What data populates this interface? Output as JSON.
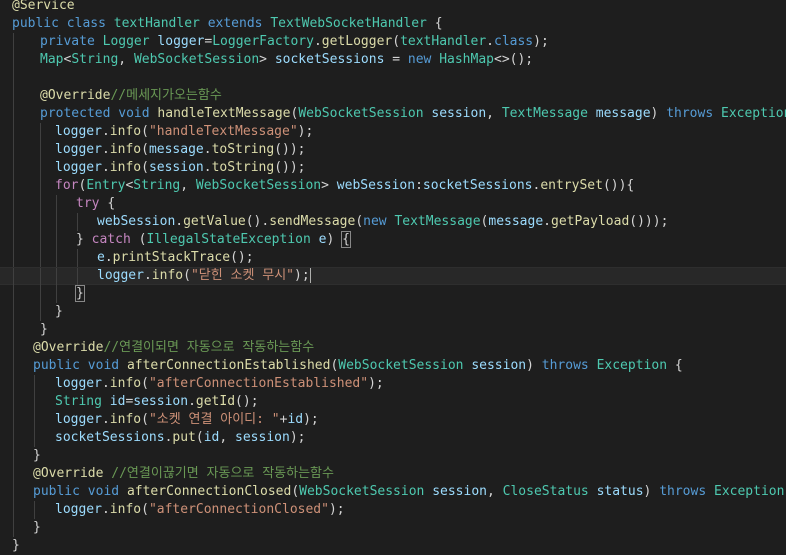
{
  "editor": {
    "language": "java",
    "theme_colors": {
      "background": "#1e1e1e",
      "keyword": "#569cd6",
      "control": "#c586c0",
      "type": "#4ec9b0",
      "variable": "#9cdcfe",
      "function": "#dcdcaa",
      "string": "#ce9178",
      "comment": "#6a9955",
      "text": "#d4d4d4"
    },
    "lines": [
      {
        "tokens": [
          [
            "ann",
            "@"
          ],
          [
            "ann",
            "Service"
          ]
        ]
      },
      {
        "tokens": [
          [
            "kw",
            "public "
          ],
          [
            "kw",
            "class "
          ],
          [
            "type",
            "textHandler "
          ],
          [
            "kw",
            "extends "
          ],
          [
            "type",
            "TextWebSocketHandler "
          ],
          [
            "plain",
            "{"
          ]
        ]
      },
      {
        "tokens": [
          [
            "kw",
            "private "
          ],
          [
            "type",
            "Logger "
          ],
          [
            "var",
            "logger"
          ],
          [
            "plain",
            "="
          ],
          [
            "type",
            "LoggerFactory"
          ],
          [
            "plain",
            "."
          ],
          [
            "fn",
            "getLogger"
          ],
          [
            "plain",
            "("
          ],
          [
            "type",
            "textHandler"
          ],
          [
            "plain",
            "."
          ],
          [
            "kw",
            "class"
          ],
          [
            "plain",
            ");"
          ]
        ]
      },
      {
        "tokens": [
          [
            "type",
            "Map"
          ],
          [
            "plain",
            "<"
          ],
          [
            "type",
            "String"
          ],
          [
            "plain",
            ", "
          ],
          [
            "type",
            "WebSocketSession"
          ],
          [
            "plain",
            "> "
          ],
          [
            "var",
            "socketSessions "
          ],
          [
            "plain",
            "= "
          ],
          [
            "kw",
            "new "
          ],
          [
            "type",
            "HashMap"
          ],
          [
            "plain",
            "<>();"
          ]
        ]
      },
      {
        "tokens": []
      },
      {
        "tokens": [
          [
            "ann",
            "@Override"
          ],
          [
            "cmt",
            "//메세지가오는함수"
          ]
        ]
      },
      {
        "tokens": [
          [
            "kw",
            "protected "
          ],
          [
            "kw",
            "void "
          ],
          [
            "fn",
            "handleTextMessage"
          ],
          [
            "plain",
            "("
          ],
          [
            "type",
            "WebSocketSession "
          ],
          [
            "var",
            "session"
          ],
          [
            "plain",
            ", "
          ],
          [
            "type",
            "TextMessage "
          ],
          [
            "var",
            "message"
          ],
          [
            "plain",
            ") "
          ],
          [
            "kw",
            "throws "
          ],
          [
            "type",
            "Exception "
          ],
          [
            "plain",
            "{"
          ]
        ]
      },
      {
        "tokens": [
          [
            "var",
            "logger"
          ],
          [
            "plain",
            "."
          ],
          [
            "fn",
            "info"
          ],
          [
            "plain",
            "("
          ],
          [
            "str",
            "\"handleTextMessage\""
          ],
          [
            "plain",
            ");"
          ]
        ]
      },
      {
        "tokens": [
          [
            "var",
            "logger"
          ],
          [
            "plain",
            "."
          ],
          [
            "fn",
            "info"
          ],
          [
            "plain",
            "("
          ],
          [
            "var",
            "message"
          ],
          [
            "plain",
            "."
          ],
          [
            "fn",
            "toString"
          ],
          [
            "plain",
            "());"
          ]
        ]
      },
      {
        "tokens": [
          [
            "var",
            "logger"
          ],
          [
            "plain",
            "."
          ],
          [
            "fn",
            "info"
          ],
          [
            "plain",
            "("
          ],
          [
            "var",
            "session"
          ],
          [
            "plain",
            "."
          ],
          [
            "fn",
            "toString"
          ],
          [
            "plain",
            "());"
          ]
        ]
      },
      {
        "tokens": [
          [
            "ctrl",
            "for"
          ],
          [
            "plain",
            "("
          ],
          [
            "type",
            "Entry"
          ],
          [
            "plain",
            "<"
          ],
          [
            "type",
            "String"
          ],
          [
            "plain",
            ", "
          ],
          [
            "type",
            "WebSocketSession"
          ],
          [
            "plain",
            "> "
          ],
          [
            "var",
            "webSession"
          ],
          [
            "plain",
            ":"
          ],
          [
            "var",
            "socketSessions"
          ],
          [
            "plain",
            "."
          ],
          [
            "fn",
            "entrySet"
          ],
          [
            "plain",
            "()){"
          ]
        ]
      },
      {
        "tokens": [
          [
            "ctrl",
            "try "
          ],
          [
            "plain",
            "{"
          ]
        ]
      },
      {
        "tokens": [
          [
            "var",
            "webSession"
          ],
          [
            "plain",
            "."
          ],
          [
            "fn",
            "getValue"
          ],
          [
            "plain",
            "()."
          ],
          [
            "fn",
            "sendMessage"
          ],
          [
            "plain",
            "("
          ],
          [
            "kw",
            "new "
          ],
          [
            "type",
            "TextMessage"
          ],
          [
            "plain",
            "("
          ],
          [
            "var",
            "message"
          ],
          [
            "plain",
            "."
          ],
          [
            "fn",
            "getPayload"
          ],
          [
            "plain",
            "()));"
          ]
        ]
      },
      {
        "tokens": [
          [
            "plain",
            "} "
          ],
          [
            "ctrl",
            "catch "
          ],
          [
            "plain",
            "("
          ],
          [
            "type",
            "IllegalStateException "
          ],
          [
            "var",
            "e"
          ],
          [
            "plain",
            ") "
          ],
          [
            "brk-match",
            "{"
          ]
        ]
      },
      {
        "tokens": [
          [
            "var",
            "e"
          ],
          [
            "plain",
            "."
          ],
          [
            "fn",
            "printStackTrace"
          ],
          [
            "plain",
            "();"
          ]
        ]
      },
      {
        "tokens": [
          [
            "var",
            "logger"
          ],
          [
            "plain",
            "."
          ],
          [
            "fn",
            "info"
          ],
          [
            "plain",
            "("
          ],
          [
            "str",
            "\"닫힌 소켓 무시\""
          ],
          [
            "plain",
            ");"
          ]
        ]
      },
      {
        "tokens": [
          [
            "brk-match",
            "}"
          ]
        ]
      },
      {
        "tokens": [
          [
            "plain",
            "}"
          ]
        ]
      },
      {
        "tokens": [
          [
            "plain",
            "}"
          ]
        ]
      },
      {
        "tokens": [
          [
            "ann",
            "@Override"
          ],
          [
            "cmt",
            "//연결이되면 자동으로 작동하는함수"
          ]
        ]
      },
      {
        "tokens": [
          [
            "kw",
            "public "
          ],
          [
            "kw",
            "void "
          ],
          [
            "fn",
            "afterConnectionEstablished"
          ],
          [
            "plain",
            "("
          ],
          [
            "type",
            "WebSocketSession "
          ],
          [
            "var",
            "session"
          ],
          [
            "plain",
            ") "
          ],
          [
            "kw",
            "throws "
          ],
          [
            "type",
            "Exception "
          ],
          [
            "plain",
            "{"
          ]
        ]
      },
      {
        "tokens": [
          [
            "var",
            "logger"
          ],
          [
            "plain",
            "."
          ],
          [
            "fn",
            "info"
          ],
          [
            "plain",
            "("
          ],
          [
            "str",
            "\"afterConnectionEstablished\""
          ],
          [
            "plain",
            ");"
          ]
        ]
      },
      {
        "tokens": [
          [
            "type",
            "String "
          ],
          [
            "var",
            "id"
          ],
          [
            "plain",
            "="
          ],
          [
            "var",
            "session"
          ],
          [
            "plain",
            "."
          ],
          [
            "fn",
            "getId"
          ],
          [
            "plain",
            "();"
          ]
        ]
      },
      {
        "tokens": [
          [
            "var",
            "logger"
          ],
          [
            "plain",
            "."
          ],
          [
            "fn",
            "info"
          ],
          [
            "plain",
            "("
          ],
          [
            "str",
            "\"소켓 연결 아이디: \""
          ],
          [
            "plain",
            "+"
          ],
          [
            "var",
            "id"
          ],
          [
            "plain",
            ");"
          ]
        ]
      },
      {
        "tokens": [
          [
            "var",
            "socketSessions"
          ],
          [
            "plain",
            "."
          ],
          [
            "fn",
            "put"
          ],
          [
            "plain",
            "("
          ],
          [
            "var",
            "id"
          ],
          [
            "plain",
            ", "
          ],
          [
            "var",
            "session"
          ],
          [
            "plain",
            ");"
          ]
        ]
      },
      {
        "tokens": [
          [
            "plain",
            "}"
          ]
        ]
      },
      {
        "tokens": [
          [
            "ann",
            "@Override "
          ],
          [
            "cmt",
            "//연결이끊기면 자동으로 작동하는함수"
          ]
        ]
      },
      {
        "tokens": [
          [
            "kw",
            "public "
          ],
          [
            "kw",
            "void "
          ],
          [
            "fn",
            "afterConnectionClosed"
          ],
          [
            "plain",
            "("
          ],
          [
            "type",
            "WebSocketSession "
          ],
          [
            "var",
            "session"
          ],
          [
            "plain",
            ", "
          ],
          [
            "type",
            "CloseStatus "
          ],
          [
            "var",
            "status"
          ],
          [
            "plain",
            ") "
          ],
          [
            "kw",
            "throws "
          ],
          [
            "type",
            "Exception "
          ],
          [
            "plain",
            "{"
          ]
        ]
      },
      {
        "tokens": [
          [
            "var",
            "logger"
          ],
          [
            "plain",
            "."
          ],
          [
            "fn",
            "info"
          ],
          [
            "plain",
            "("
          ],
          [
            "str",
            "\"afterConnectionClosed\""
          ],
          [
            "plain",
            ");"
          ]
        ]
      },
      {
        "tokens": [
          [
            "plain",
            "}"
          ]
        ]
      },
      {
        "tokens": [
          [
            "plain",
            "}"
          ]
        ]
      }
    ]
  }
}
